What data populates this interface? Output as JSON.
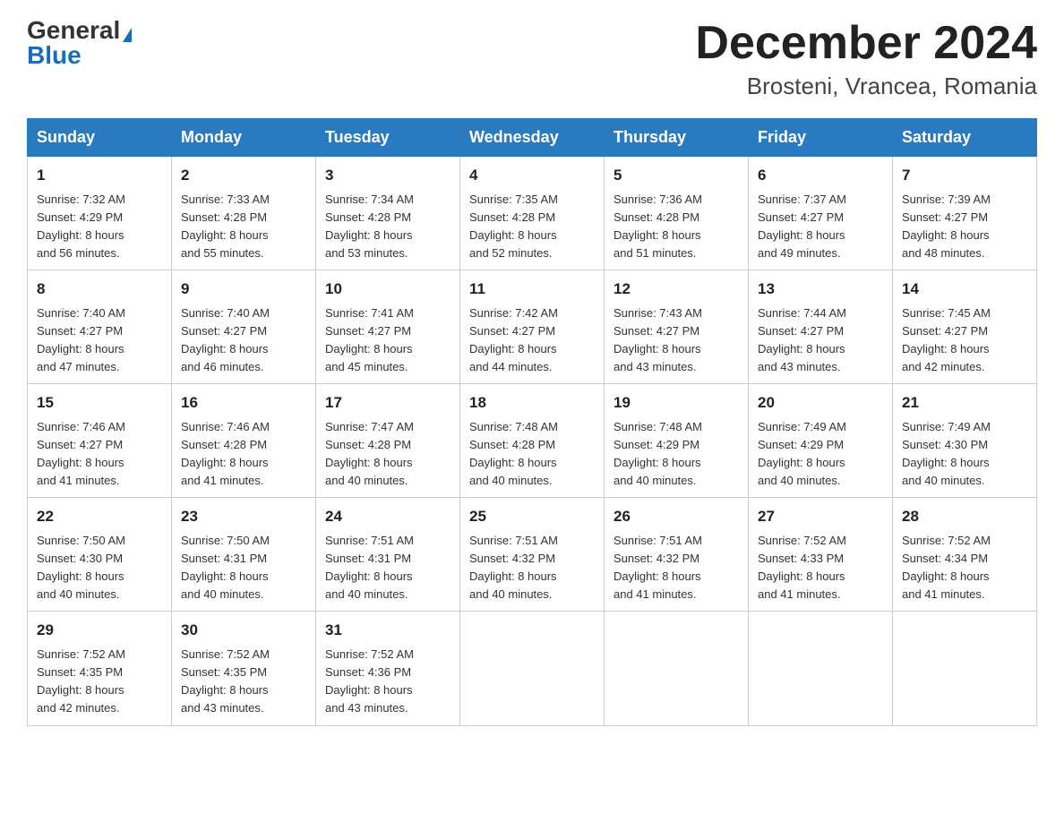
{
  "logo": {
    "general": "General",
    "blue": "Blue",
    "triangle": "▲"
  },
  "title": "December 2024",
  "subtitle": "Brosteni, Vrancea, Romania",
  "days_of_week": [
    "Sunday",
    "Monday",
    "Tuesday",
    "Wednesday",
    "Thursday",
    "Friday",
    "Saturday"
  ],
  "weeks": [
    [
      {
        "day": "1",
        "sunrise": "7:32 AM",
        "sunset": "4:29 PM",
        "daylight": "8 hours and 56 minutes."
      },
      {
        "day": "2",
        "sunrise": "7:33 AM",
        "sunset": "4:28 PM",
        "daylight": "8 hours and 55 minutes."
      },
      {
        "day": "3",
        "sunrise": "7:34 AM",
        "sunset": "4:28 PM",
        "daylight": "8 hours and 53 minutes."
      },
      {
        "day": "4",
        "sunrise": "7:35 AM",
        "sunset": "4:28 PM",
        "daylight": "8 hours and 52 minutes."
      },
      {
        "day": "5",
        "sunrise": "7:36 AM",
        "sunset": "4:28 PM",
        "daylight": "8 hours and 51 minutes."
      },
      {
        "day": "6",
        "sunrise": "7:37 AM",
        "sunset": "4:27 PM",
        "daylight": "8 hours and 49 minutes."
      },
      {
        "day": "7",
        "sunrise": "7:39 AM",
        "sunset": "4:27 PM",
        "daylight": "8 hours and 48 minutes."
      }
    ],
    [
      {
        "day": "8",
        "sunrise": "7:40 AM",
        "sunset": "4:27 PM",
        "daylight": "8 hours and 47 minutes."
      },
      {
        "day": "9",
        "sunrise": "7:40 AM",
        "sunset": "4:27 PM",
        "daylight": "8 hours and 46 minutes."
      },
      {
        "day": "10",
        "sunrise": "7:41 AM",
        "sunset": "4:27 PM",
        "daylight": "8 hours and 45 minutes."
      },
      {
        "day": "11",
        "sunrise": "7:42 AM",
        "sunset": "4:27 PM",
        "daylight": "8 hours and 44 minutes."
      },
      {
        "day": "12",
        "sunrise": "7:43 AM",
        "sunset": "4:27 PM",
        "daylight": "8 hours and 43 minutes."
      },
      {
        "day": "13",
        "sunrise": "7:44 AM",
        "sunset": "4:27 PM",
        "daylight": "8 hours and 43 minutes."
      },
      {
        "day": "14",
        "sunrise": "7:45 AM",
        "sunset": "4:27 PM",
        "daylight": "8 hours and 42 minutes."
      }
    ],
    [
      {
        "day": "15",
        "sunrise": "7:46 AM",
        "sunset": "4:27 PM",
        "daylight": "8 hours and 41 minutes."
      },
      {
        "day": "16",
        "sunrise": "7:46 AM",
        "sunset": "4:28 PM",
        "daylight": "8 hours and 41 minutes."
      },
      {
        "day": "17",
        "sunrise": "7:47 AM",
        "sunset": "4:28 PM",
        "daylight": "8 hours and 40 minutes."
      },
      {
        "day": "18",
        "sunrise": "7:48 AM",
        "sunset": "4:28 PM",
        "daylight": "8 hours and 40 minutes."
      },
      {
        "day": "19",
        "sunrise": "7:48 AM",
        "sunset": "4:29 PM",
        "daylight": "8 hours and 40 minutes."
      },
      {
        "day": "20",
        "sunrise": "7:49 AM",
        "sunset": "4:29 PM",
        "daylight": "8 hours and 40 minutes."
      },
      {
        "day": "21",
        "sunrise": "7:49 AM",
        "sunset": "4:30 PM",
        "daylight": "8 hours and 40 minutes."
      }
    ],
    [
      {
        "day": "22",
        "sunrise": "7:50 AM",
        "sunset": "4:30 PM",
        "daylight": "8 hours and 40 minutes."
      },
      {
        "day": "23",
        "sunrise": "7:50 AM",
        "sunset": "4:31 PM",
        "daylight": "8 hours and 40 minutes."
      },
      {
        "day": "24",
        "sunrise": "7:51 AM",
        "sunset": "4:31 PM",
        "daylight": "8 hours and 40 minutes."
      },
      {
        "day": "25",
        "sunrise": "7:51 AM",
        "sunset": "4:32 PM",
        "daylight": "8 hours and 40 minutes."
      },
      {
        "day": "26",
        "sunrise": "7:51 AM",
        "sunset": "4:32 PM",
        "daylight": "8 hours and 41 minutes."
      },
      {
        "day": "27",
        "sunrise": "7:52 AM",
        "sunset": "4:33 PM",
        "daylight": "8 hours and 41 minutes."
      },
      {
        "day": "28",
        "sunrise": "7:52 AM",
        "sunset": "4:34 PM",
        "daylight": "8 hours and 41 minutes."
      }
    ],
    [
      {
        "day": "29",
        "sunrise": "7:52 AM",
        "sunset": "4:35 PM",
        "daylight": "8 hours and 42 minutes."
      },
      {
        "day": "30",
        "sunrise": "7:52 AM",
        "sunset": "4:35 PM",
        "daylight": "8 hours and 43 minutes."
      },
      {
        "day": "31",
        "sunrise": "7:52 AM",
        "sunset": "4:36 PM",
        "daylight": "8 hours and 43 minutes."
      },
      null,
      null,
      null,
      null
    ]
  ],
  "labels": {
    "sunrise": "Sunrise:",
    "sunset": "Sunset:",
    "daylight": "Daylight:"
  },
  "colors": {
    "header_bg": "#2a7abf",
    "header_text": "#ffffff",
    "border": "#999999"
  }
}
